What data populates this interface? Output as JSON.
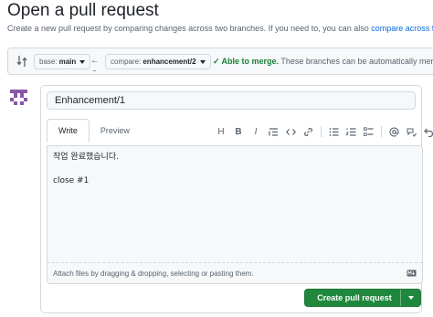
{
  "header": {
    "title": "Open a pull request",
    "subtitle": "Create a new pull request by comparing changes across two branches. If you need to, you can also ",
    "subtitle_link": "compare across fo"
  },
  "range": {
    "base_label": "base:",
    "base_value": "main",
    "compare_label": "compare:",
    "compare_value": "enhancement/2",
    "dots": "...",
    "merge_status": "Able to merge.",
    "merge_message": " These branches can be automatically merg"
  },
  "form": {
    "title_value": "Enhancement/1",
    "tabs": [
      {
        "label": "Write",
        "active": true
      },
      {
        "label": "Preview",
        "active": false
      }
    ],
    "toolbar": {
      "heading": "H",
      "bold": "B",
      "italic": "I"
    },
    "body_value": "작업 완료했습니다.\n\nclose #1",
    "attach_text": "Attach files by dragging & dropping, selecting or pasting them.",
    "create_button": "Create pull request"
  },
  "colors": {
    "primary_button": "#1f883d",
    "success_text": "#1a7f37",
    "link": "#0969da",
    "avatar": "#8957a8"
  }
}
